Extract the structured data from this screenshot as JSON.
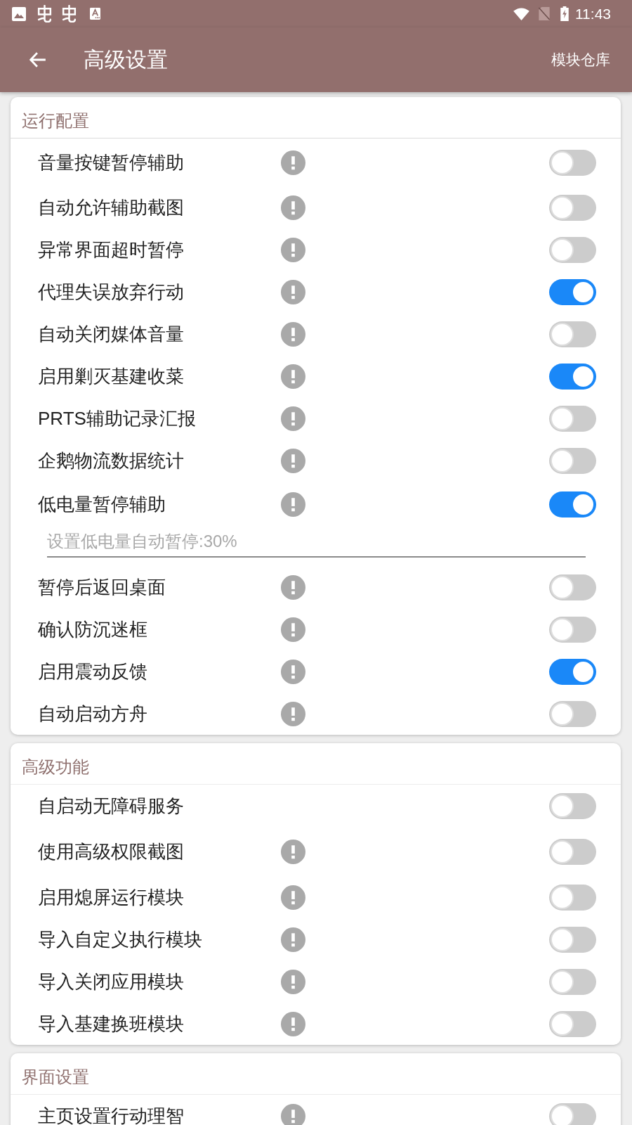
{
  "status_bar": {
    "time": "11:43"
  },
  "toolbar": {
    "title": "高级设置",
    "action": "模块仓库"
  },
  "sections": [
    {
      "title": "运行配置",
      "items": [
        {
          "label": "音量按键暂停辅助",
          "info": true,
          "on": false
        },
        {
          "label": "自动允许辅助截图",
          "info": true,
          "on": false
        },
        {
          "label": "异常界面超时暂停",
          "info": true,
          "on": false
        },
        {
          "label": "代理失误放弃行动",
          "info": true,
          "on": true
        },
        {
          "label": "自动关闭媒体音量",
          "info": true,
          "on": false
        },
        {
          "label": "启用剿灭基建收菜",
          "info": true,
          "on": true
        },
        {
          "label": "PRTS辅助记录汇报",
          "info": true,
          "on": false
        },
        {
          "label": "企鹅物流数据统计",
          "info": true,
          "on": false
        },
        {
          "label": "低电量暂停辅助",
          "info": true,
          "on": true,
          "field": {
            "placeholder": "设置低电量自动暂停:30%"
          }
        },
        {
          "label": "暂停后返回桌面",
          "info": true,
          "on": false
        },
        {
          "label": "确认防沉迷框",
          "info": true,
          "on": false
        },
        {
          "label": "启用震动反馈",
          "info": true,
          "on": true
        },
        {
          "label": "自动启动方舟",
          "info": true,
          "on": false
        }
      ]
    },
    {
      "title": "高级功能",
      "items": [
        {
          "label": "自启动无障碍服务",
          "info": false,
          "on": false
        },
        {
          "label": "使用高级权限截图",
          "info": true,
          "on": false
        },
        {
          "label": "启用熄屏运行模块",
          "info": true,
          "on": false
        },
        {
          "label": "导入自定义执行模块",
          "info": true,
          "on": false
        },
        {
          "label": "导入关闭应用模块",
          "info": true,
          "on": false
        },
        {
          "label": "导入基建换班模块",
          "info": true,
          "on": false
        }
      ]
    },
    {
      "title": "界面设置",
      "items": [
        {
          "label": "主页设置行动理智",
          "info": true,
          "on": false
        }
      ]
    }
  ]
}
